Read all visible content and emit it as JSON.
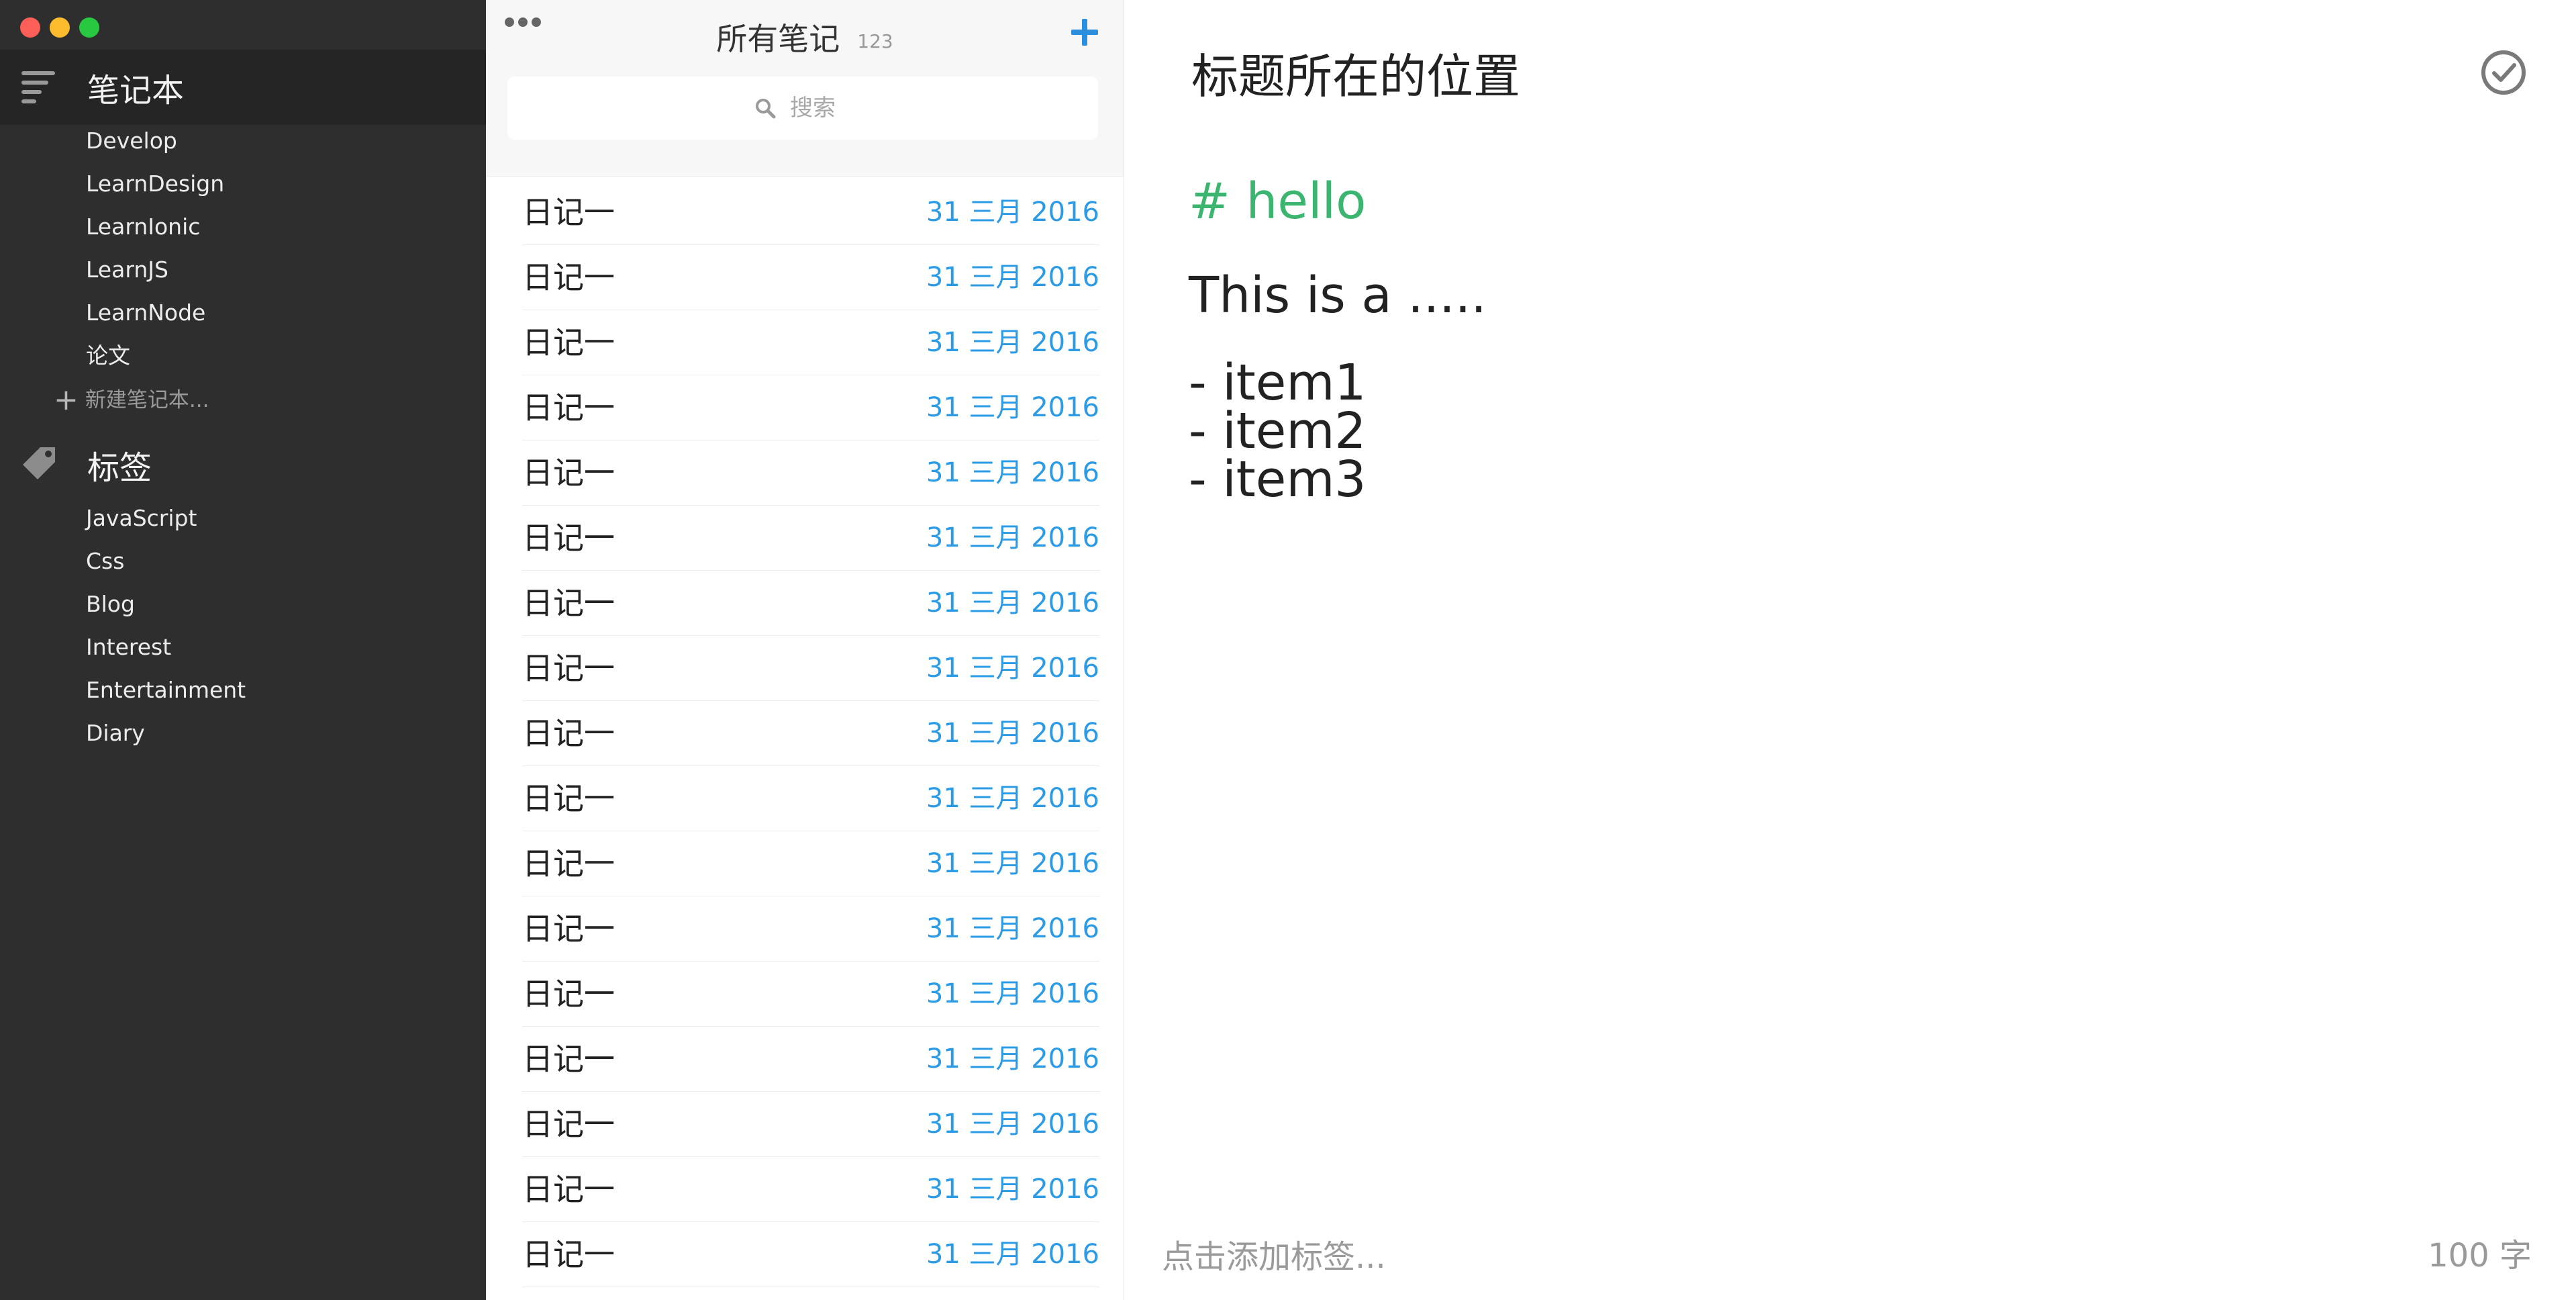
{
  "sidebar": {
    "notebooks_title": "笔记本",
    "notebooks": [
      "Develop",
      "LearnDesign",
      "LearnIonic",
      "LearnJS",
      "LearnNode",
      "论文"
    ],
    "new_notebook": "新建笔记本...",
    "tags_title": "标签",
    "tags": [
      "JavaScript",
      "Css",
      "Blog",
      "Interest",
      "Entertainment",
      "Diary"
    ],
    "icons": {
      "notebooks": "menu-lines-icon",
      "tags": "tag-icon",
      "new": "plus-icon"
    }
  },
  "notelist": {
    "title": "所有笔记",
    "count": "123",
    "search_placeholder": "搜索",
    "add_icon": "plus-icon",
    "more_icon": "more-dots-icon",
    "notes": [
      {
        "title": "日记一",
        "date": "31 三月 2016"
      },
      {
        "title": "日记一",
        "date": "31 三月 2016"
      },
      {
        "title": "日记一",
        "date": "31 三月 2016"
      },
      {
        "title": "日记一",
        "date": "31 三月 2016"
      },
      {
        "title": "日记一",
        "date": "31 三月 2016"
      },
      {
        "title": "日记一",
        "date": "31 三月 2016"
      },
      {
        "title": "日记一",
        "date": "31 三月 2016"
      },
      {
        "title": "日记一",
        "date": "31 三月 2016"
      },
      {
        "title": "日记一",
        "date": "31 三月 2016"
      },
      {
        "title": "日记一",
        "date": "31 三月 2016"
      },
      {
        "title": "日记一",
        "date": "31 三月 2016"
      },
      {
        "title": "日记一",
        "date": "31 三月 2016"
      },
      {
        "title": "日记一",
        "date": "31 三月 2016"
      },
      {
        "title": "日记一",
        "date": "31 三月 2016"
      },
      {
        "title": "日记一",
        "date": "31 三月 2016"
      },
      {
        "title": "日记一",
        "date": "31 三月 2016"
      },
      {
        "title": "日记一",
        "date": "31 三月 2016"
      }
    ]
  },
  "editor": {
    "title": "标题所在的位置",
    "heading": "# hello",
    "paragraph": "This is a .....",
    "list_items": [
      "- item1",
      "- item2",
      "- item3"
    ],
    "tag_placeholder": "点击添加标签...",
    "word_count": "100 字",
    "done_icon": "check-circle-icon"
  },
  "colors": {
    "sidebar_bg": "#2e2e2e",
    "accent_blue": "#2b9be6",
    "heading_green": "#3bb56f"
  }
}
